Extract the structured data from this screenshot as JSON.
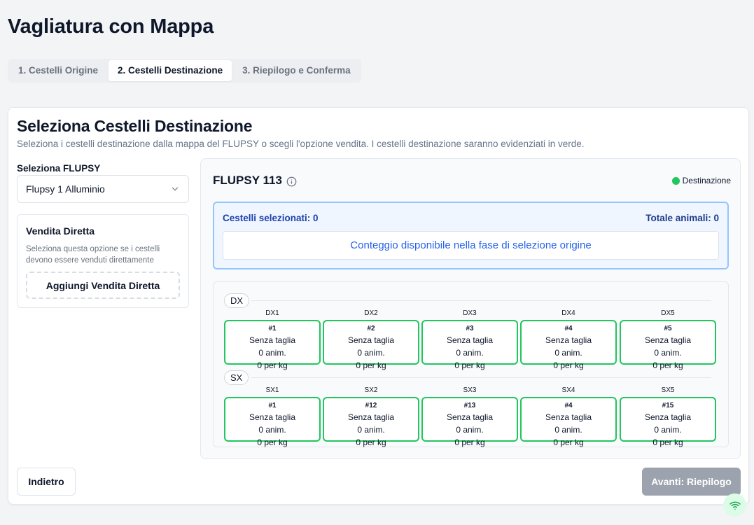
{
  "page_title": "Vagliatura con Mappa",
  "tabs": [
    {
      "label": "1. Cestelli Origine",
      "active": false
    },
    {
      "label": "2. Cestelli Destinazione",
      "active": true
    },
    {
      "label": "3. Riepilogo e Conferma",
      "active": false
    }
  ],
  "card": {
    "title": "Seleziona Cestelli Destinazione",
    "description": "Seleziona i cestelli destinazione dalla mappa del FLUPSY o scegli l'opzione vendita. I cestelli destinazione saranno evidenziati in verde."
  },
  "flupsy_select": {
    "label": "Seleziona FLUPSY",
    "value": "Flupsy 1 Alluminio"
  },
  "vendita": {
    "title": "Vendita Diretta",
    "description": "Seleziona questa opzione se i cestelli devono essere venduti direttamente",
    "button": "Aggiungi Vendita Diretta"
  },
  "map": {
    "title": "FLUPSY 113",
    "legend_label": "Destinazione",
    "legend_color": "#22c55e",
    "summary": {
      "selected": "Cestelli selezionati: 0",
      "total": "Totale animali: 0",
      "message": "Conteggio disponibile nella fase di selezione origine"
    },
    "rows": [
      {
        "name": "DX",
        "cells": [
          {
            "pos": "DX1",
            "num": "#1",
            "size": "Senza taglia",
            "anim": "0 anim.",
            "kg": "0 per kg"
          },
          {
            "pos": "DX2",
            "num": "#2",
            "size": "Senza taglia",
            "anim": "0 anim.",
            "kg": "0 per kg"
          },
          {
            "pos": "DX3",
            "num": "#3",
            "size": "Senza taglia",
            "anim": "0 anim.",
            "kg": "0 per kg"
          },
          {
            "pos": "DX4",
            "num": "#4",
            "size": "Senza taglia",
            "anim": "0 anim.",
            "kg": "0 per kg"
          },
          {
            "pos": "DX5",
            "num": "#5",
            "size": "Senza taglia",
            "anim": "0 anim.",
            "kg": "0 per kg"
          }
        ]
      },
      {
        "name": "SX",
        "cells": [
          {
            "pos": "SX1",
            "num": "#1",
            "size": "Senza taglia",
            "anim": "0 anim.",
            "kg": "0 per kg"
          },
          {
            "pos": "SX2",
            "num": "#12",
            "size": "Senza taglia",
            "anim": "0 anim.",
            "kg": "0 per kg"
          },
          {
            "pos": "SX3",
            "num": "#13",
            "size": "Senza taglia",
            "anim": "0 anim.",
            "kg": "0 per kg"
          },
          {
            "pos": "SX4",
            "num": "#4",
            "size": "Senza taglia",
            "anim": "0 anim.",
            "kg": "0 per kg"
          },
          {
            "pos": "SX5",
            "num": "#15",
            "size": "Senza taglia",
            "anim": "0 anim.",
            "kg": "0 per kg"
          }
        ]
      }
    ]
  },
  "buttons": {
    "back": "Indietro",
    "next": "Avanti: Riepilogo"
  }
}
